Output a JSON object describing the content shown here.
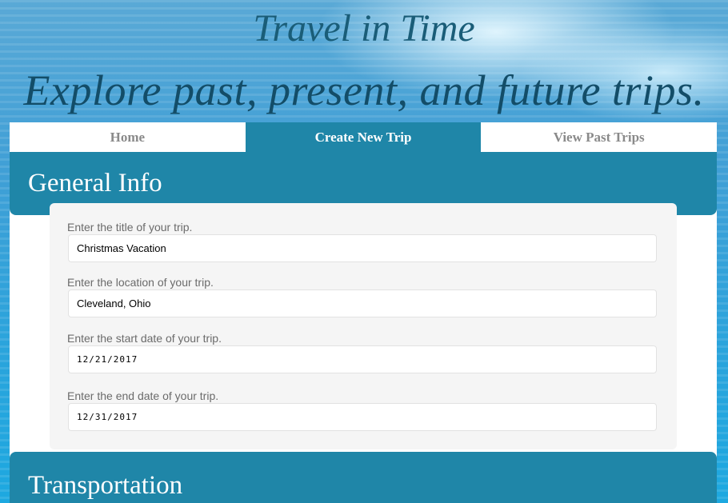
{
  "hero": {
    "title": "Travel in Time",
    "subtitle": "Explore past, present, and future trips."
  },
  "nav": {
    "items": [
      {
        "label": "Home",
        "active": false
      },
      {
        "label": "Create New Trip",
        "active": true
      },
      {
        "label": "View Past Trips",
        "active": false
      }
    ]
  },
  "sections": {
    "general_info": "General Info",
    "transportation": "Transportation"
  },
  "form": {
    "fields": [
      {
        "label": "Enter the title of your trip.",
        "value": "Christmas Vacation"
      },
      {
        "label": "Enter the location of your trip.",
        "value": "Cleveland, Ohio"
      },
      {
        "label": "Enter the start date of your trip.",
        "value": "12/21/2017"
      },
      {
        "label": "Enter the end date of your trip.",
        "value": "12/31/2017"
      }
    ]
  },
  "colors": {
    "accent": "#1f86a8",
    "hero_text": "#1a5d78",
    "nav_inactive_text": "#8a8a8a"
  }
}
